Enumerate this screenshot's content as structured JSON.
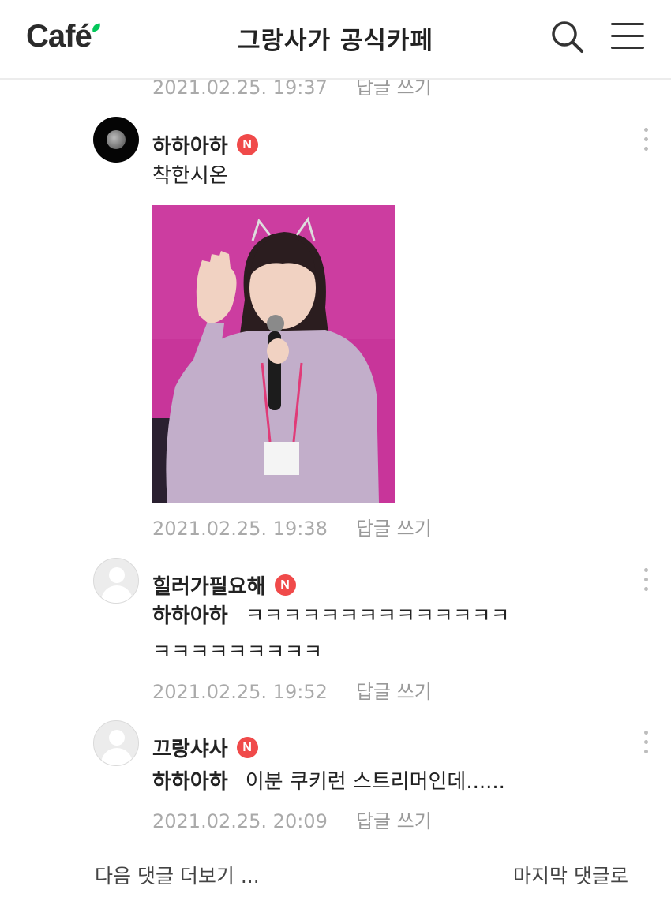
{
  "header": {
    "logo": "Café",
    "title": "그랑사가 공식카페",
    "search_icon": "search-icon",
    "menu_icon": "hamburger-menu-icon"
  },
  "prev_comment": {
    "date": "2021.02.25. 19:37",
    "reply_label": "답글 쓰기"
  },
  "comments": [
    {
      "nickname": "하하아하",
      "badge": "N",
      "text": "착한시온",
      "has_image": true,
      "date": "2021.02.25. 19:38",
      "reply_label": "답글 쓰기"
    },
    {
      "nickname": "힐러가필요해",
      "badge": "N",
      "mention": "하하아하",
      "text_line1": "ㅋㅋㅋㅋㅋㅋㅋㅋㅋㅋㅋㅋㅋㅋ",
      "text_line2": "ㅋㅋㅋㅋㅋㅋㅋㅋㅋ",
      "date": "2021.02.25. 19:52",
      "reply_label": "답글 쓰기"
    },
    {
      "nickname": "끄랑샤사",
      "badge": "N",
      "mention": "하하아하",
      "text": "이분 쿠키런 스트리머인데......",
      "date": "2021.02.25. 20:09",
      "reply_label": "답글 쓰기"
    }
  ],
  "footer": {
    "more_label": "다음 댓글 더보기 ...",
    "last_label": "마지막 댓글로"
  },
  "colors": {
    "badge": "#f04a4a",
    "meta_text": "#aaaaaa",
    "photo_background": "#c8359a"
  }
}
